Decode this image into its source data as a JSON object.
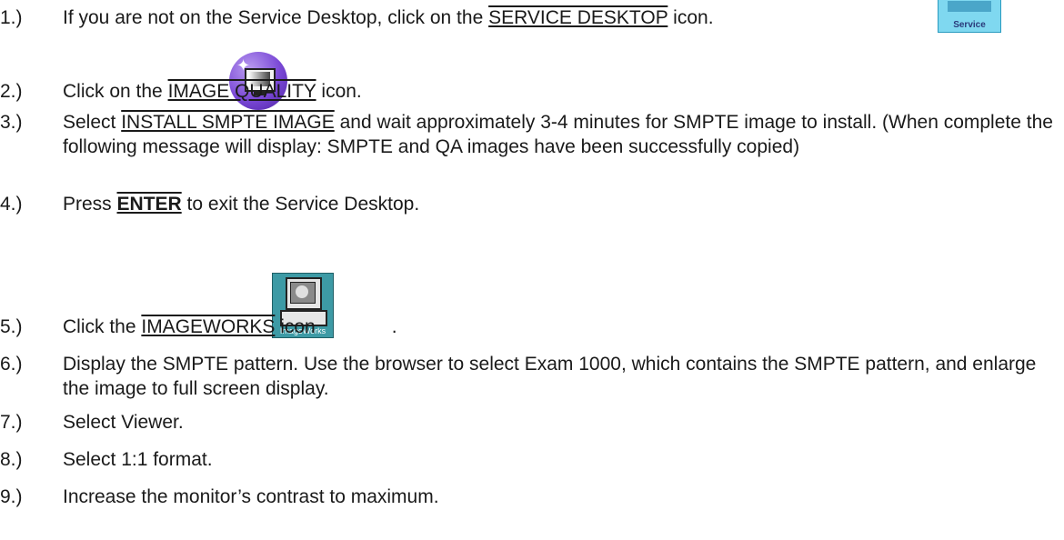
{
  "steps": [
    {
      "num": "1.)",
      "pre": "If you are not on the Service Desktop, click on the ",
      "key": "SERVICE DESKTOP",
      "post": " icon."
    },
    {
      "num": "2.)",
      "pre": "Click on the ",
      "key": "IMAGE QUALITY",
      "post": " icon."
    },
    {
      "num": "3.)",
      "pre": "Select ",
      "key": "INSTALL SMPTE IMAGE",
      "post": " and wait approximately 3-4 minutes for SMPTE image to install. (When complete the following message will display: SMPTE and QA images have been successfully copied)"
    },
    {
      "num": "4.)",
      "pre": "Press ",
      "key": "ENTER",
      "post": " to exit the Service Desktop."
    },
    {
      "num": "5.)",
      "pre": "Click the ",
      "key": "IMAGEWORKS",
      "post": " icon",
      "tail": "."
    },
    {
      "num": "6.)",
      "text": "Display the SMPTE pattern. Use the browser to select Exam 1000, which contains the SMPTE pattern, and enlarge the image to full screen display."
    },
    {
      "num": "7.)",
      "text": "Select Viewer."
    },
    {
      "num": "8.)",
      "text": "Select 1:1 format."
    },
    {
      "num": "9.)",
      "text": "Increase the monitor’s contrast to maximum."
    }
  ],
  "icons": {
    "service_label": "Service",
    "imageworks_label": "ImageWorks"
  }
}
